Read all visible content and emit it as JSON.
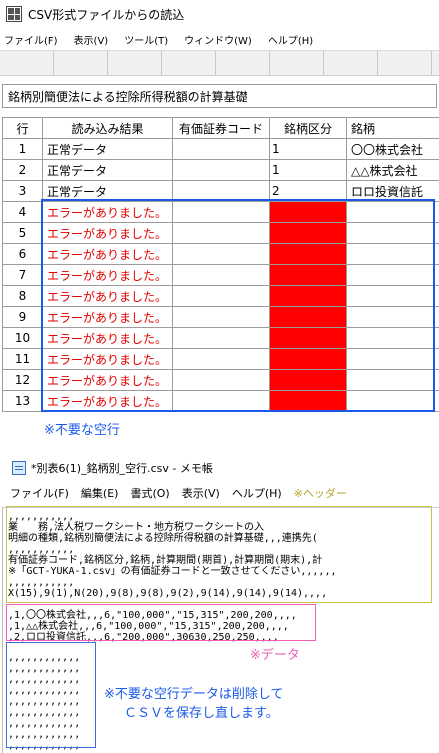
{
  "app": {
    "title": "CSV形式ファイルからの読込",
    "menu": [
      "ファイル(F)",
      "表示(V)",
      "ツール(T)",
      "ウィンドウ(W)",
      "ヘルプ(H)"
    ],
    "sheet_title": "銘柄別簡便法による控除所得税額の計算基礎",
    "columns": [
      "行",
      "読み込み結果",
      "有価証券コード",
      "銘柄区分",
      "銘柄"
    ],
    "rows": [
      {
        "no": "1",
        "result": "正常データ",
        "code": "",
        "div": "1",
        "name": "〇〇株式会社",
        "error": false
      },
      {
        "no": "2",
        "result": "正常データ",
        "code": "",
        "div": "1",
        "name": "△△株式会社",
        "error": false
      },
      {
        "no": "3",
        "result": "正常データ",
        "code": "",
        "div": "2",
        "name": "ロロ投資信託",
        "error": false
      },
      {
        "no": "4",
        "result": "エラーがありました。",
        "code": "",
        "div": "",
        "name": "",
        "error": true
      },
      {
        "no": "5",
        "result": "エラーがありました。",
        "code": "",
        "div": "",
        "name": "",
        "error": true
      },
      {
        "no": "6",
        "result": "エラーがありました。",
        "code": "",
        "div": "",
        "name": "",
        "error": true
      },
      {
        "no": "7",
        "result": "エラーがありました。",
        "code": "",
        "div": "",
        "name": "",
        "error": true
      },
      {
        "no": "8",
        "result": "エラーがありました。",
        "code": "",
        "div": "",
        "name": "",
        "error": true
      },
      {
        "no": "9",
        "result": "エラーがありました。",
        "code": "",
        "div": "",
        "name": "",
        "error": true
      },
      {
        "no": "10",
        "result": "エラーがありました。",
        "code": "",
        "div": "",
        "name": "",
        "error": true
      },
      {
        "no": "11",
        "result": "エラーがありました。",
        "code": "",
        "div": "",
        "name": "",
        "error": true
      },
      {
        "no": "12",
        "result": "エラーがありました。",
        "code": "",
        "div": "",
        "name": "",
        "error": true
      },
      {
        "no": "13",
        "result": "エラーがありました。",
        "code": "",
        "div": "",
        "name": "",
        "error": true
      }
    ],
    "note_blank_rows": "※不要な空行"
  },
  "notepad": {
    "title": "*別表6(1)_銘柄別_空行.csv - メモ帳",
    "menu": [
      "ファイル(F)",
      "編集(E)",
      "書式(O)",
      "表示(V)",
      "ヘルプ(H)"
    ],
    "header_note": "※ヘッダー",
    "lines": [
      ",,,,,,,,,,,",
      "業　　務,法人税ワークシート・地方税ワークシートの入",
      "明細の種類,銘柄別簡便法による控除所得税額の計算基礎,,,連携先(",
      ",,,,,,,,,,,",
      "有価証券コード,銘柄区分,銘柄,計算期間(期首),計算期間(期末),計",
      "※「GCT-YUKA-1.csv」の有価証券コードと一致させてください,,,,,,",
      ",,,,,,,,,,,",
      "X(15),9(1),N(20),9(8),9(8),9(2),9(14),9(14),9(14),,,,",
      ",1,〇〇株式会社,,,6,\"100,000\",\"15,315\",200,200,,,,",
      ",1,△△株式会社,,,6,\"100,000\",\"15,315\",200,200,,,,",
      ",2,ロロ投資信託,,,6,\"200,000\",30630,250,250,,,,",
      ",,,,,,,,,,,,",
      ",,,,,,,,,,,,",
      ",,,,,,,,,,,,",
      ",,,,,,,,,,,,",
      ",,,,,,,,,,,,",
      ",,,,,,,,,,,,",
      ",,,,,,,,,,,,",
      ",,,,,,,,,,,,",
      ",,,,,,,,,,,,"
    ],
    "data_note": "※データ",
    "delete_note_line1": "※不要な空行データは削除して",
    "delete_note_line2": "ＣＳＶを保存し直します。"
  }
}
